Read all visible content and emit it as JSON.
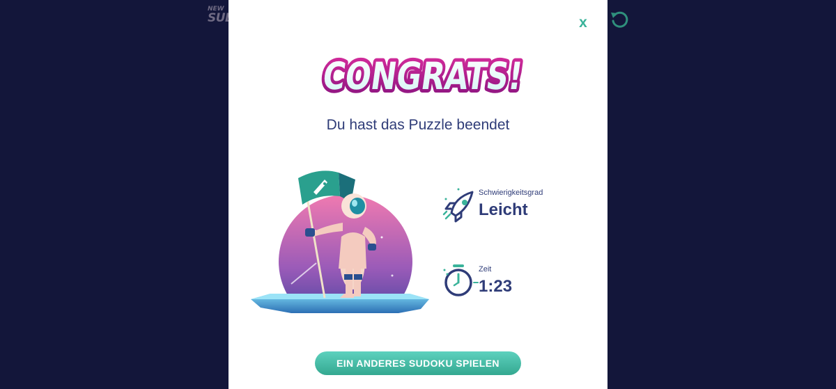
{
  "background": {
    "logo_top": "NEW",
    "logo_bottom": "SUDO"
  },
  "modal": {
    "close_label": "x",
    "banner_text": "CONGRATS!",
    "subtitle": "Du hast das Puzzle beendet",
    "stats": {
      "difficulty": {
        "label": "Schwierigkeitsgrad",
        "value": "Leicht",
        "icon": "rocket-icon"
      },
      "time": {
        "label": "Zeit",
        "value": "1:23",
        "icon": "stopwatch-icon"
      }
    },
    "cta_label": "EIN ANDERES SUDOKU SPIELEN"
  },
  "colors": {
    "page_background": "#13163a",
    "accent": "#3ab39a",
    "text_primary": "#2f3c78",
    "banner_magenta": "#b2188c"
  }
}
